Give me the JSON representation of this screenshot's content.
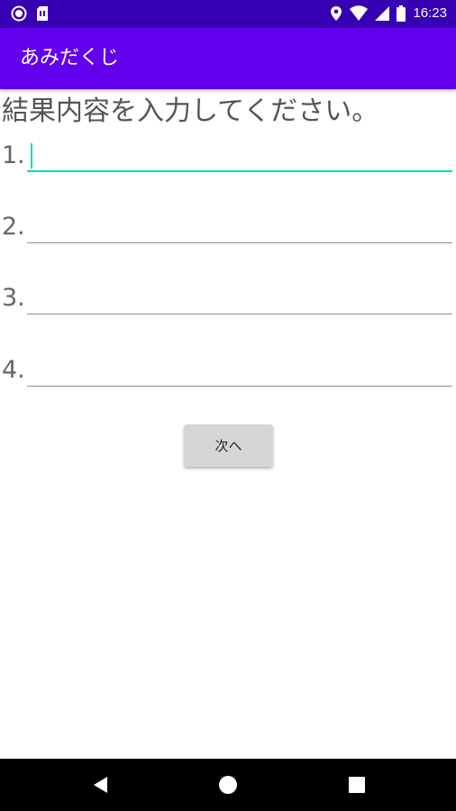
{
  "status_bar": {
    "time": "16:23",
    "icons": [
      "notification-dot-icon",
      "sim-card-icon",
      "location-icon",
      "wifi-icon",
      "cellular-signal-icon",
      "battery-icon"
    ]
  },
  "app_bar": {
    "title": "あみだくじ"
  },
  "content": {
    "prompt": "結果内容を入力してください。",
    "fields": [
      {
        "label": "1.",
        "value": "",
        "focused": true
      },
      {
        "label": "2.",
        "value": ""
      },
      {
        "label": "3.",
        "value": ""
      },
      {
        "label": "4.",
        "value": ""
      }
    ],
    "next_button_label": "次へ"
  },
  "nav_bar": {
    "buttons": [
      "back-icon",
      "home-icon",
      "recents-icon"
    ]
  },
  "colors": {
    "status_bar": "#3700b3",
    "app_bar": "#6200ee",
    "accent": "#03dac5"
  }
}
